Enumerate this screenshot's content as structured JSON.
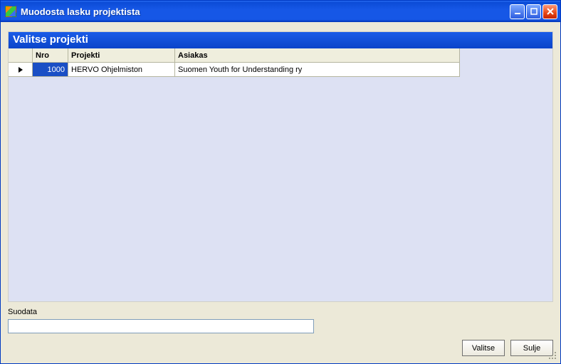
{
  "window": {
    "title": "Muodosta lasku projektista"
  },
  "panel": {
    "title": "Valitse projekti"
  },
  "grid": {
    "headers": {
      "nro": "Nro",
      "projekti": "Projekti",
      "asiakas": "Asiakas"
    },
    "rows": [
      {
        "nro": "1000",
        "projekti": "HERVO Ohjelmiston",
        "asiakas": "Suomen Youth for Understanding ry"
      }
    ]
  },
  "filter": {
    "label": "Suodata",
    "value": ""
  },
  "buttons": {
    "select": "Valitse",
    "close": "Sulje"
  }
}
